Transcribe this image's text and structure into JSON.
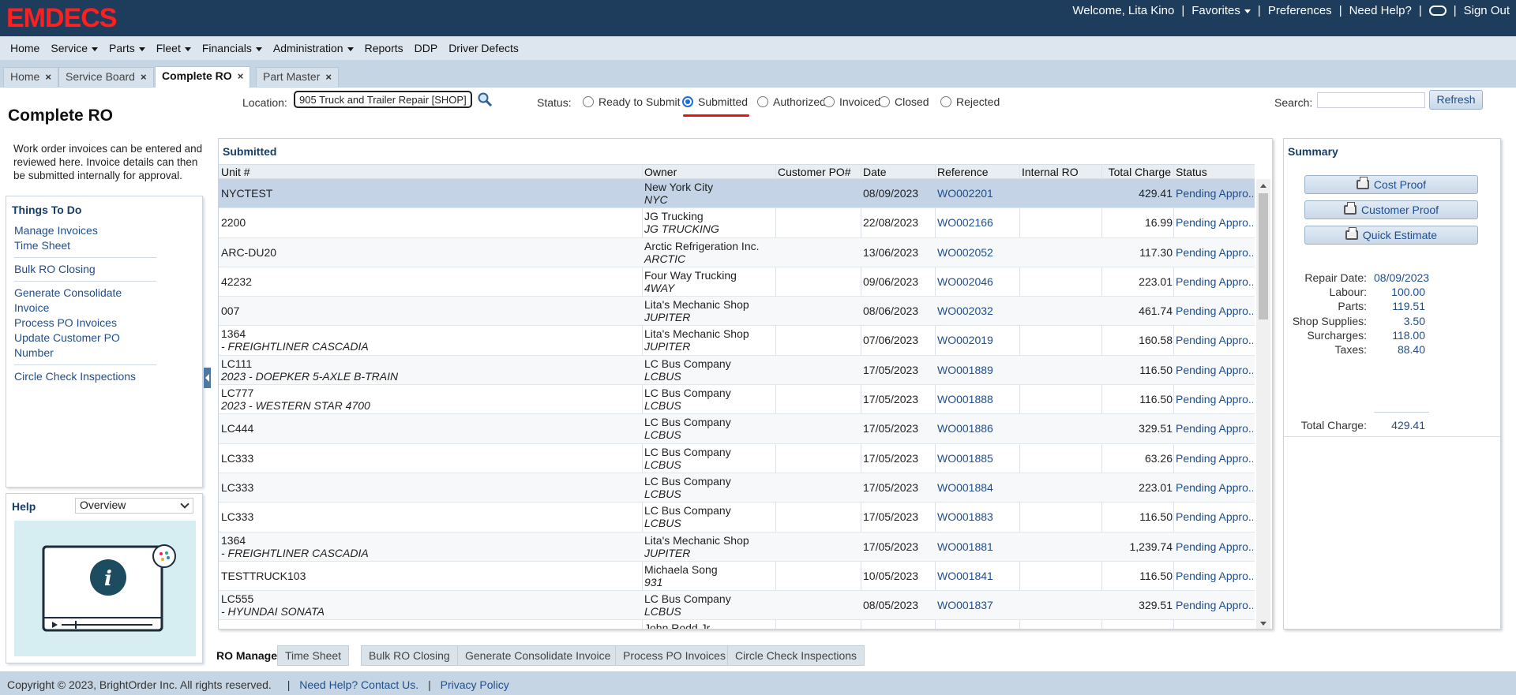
{
  "app": {
    "logo": "EMDECS"
  },
  "user_bar": {
    "welcome": "Welcome, Lita Kino",
    "favorites": "Favorites",
    "preferences": "Preferences",
    "need_help": "Need Help?",
    "sign_out": "Sign Out"
  },
  "menu": [
    "Home",
    "Service",
    "Parts",
    "Fleet",
    "Financials",
    "Administration",
    "Reports",
    "DDP",
    "Driver Defects"
  ],
  "menu_dropdown": [
    false,
    true,
    true,
    true,
    true,
    true,
    false,
    false,
    false
  ],
  "tabs": [
    {
      "label": "Home"
    },
    {
      "label": "Service Board"
    },
    {
      "label": "Complete RO",
      "active": true
    },
    {
      "label": "Part Master"
    }
  ],
  "sidebar": {
    "title": "Complete RO",
    "intro": "Work order invoices can be entered and reviewed here. Invoice details can then be submitted internally for approval.",
    "todo_title": "Things To Do",
    "todo_links": [
      [
        "Manage Invoices",
        "Time Sheet"
      ],
      [
        "Bulk RO Closing"
      ],
      [
        "Generate Consolidate Invoice",
        "Process PO Invoices",
        "Update Customer PO Number"
      ],
      [
        "Circle Check Inspections"
      ]
    ],
    "help_title": "Help",
    "help_select": "Overview"
  },
  "filter": {
    "location_label": "Location:",
    "location_value": "905 Truck and Trailer Repair [SHOP]",
    "status_label": "Status:",
    "statuses": [
      "Ready to Submit",
      "Submitted",
      "Authorized",
      "Invoiced",
      "Closed",
      "Rejected"
    ],
    "selected_status": "Submitted",
    "search_label": "Search:",
    "search_value": "",
    "refresh": "Refresh"
  },
  "grid": {
    "title": "Submitted",
    "columns": [
      "Unit #",
      "Owner",
      "Customer PO#",
      "Date",
      "Reference",
      "Internal RO",
      "Total Charge",
      "Status"
    ],
    "rows": [
      {
        "unit": "NYCTEST",
        "unit2": "",
        "owner": "New York City",
        "owner2": "NYC",
        "po": "",
        "date": "08/09/2023",
        "ref": "WO002201",
        "iro": "",
        "total": "429.41",
        "status": "Pending Appro..."
      },
      {
        "unit": "2200",
        "unit2": "",
        "owner": "JG Trucking",
        "owner2": "JG TRUCKING",
        "po": "",
        "date": "22/08/2023",
        "ref": "WO002166",
        "iro": "",
        "total": "16.99",
        "status": "Pending Appro..."
      },
      {
        "unit": "ARC-DU20",
        "unit2": "",
        "owner": "Arctic Refrigeration Inc.",
        "owner2": "ARCTIC",
        "po": "",
        "date": "13/06/2023",
        "ref": "WO002052",
        "iro": "",
        "total": "117.30",
        "status": "Pending Appro..."
      },
      {
        "unit": "42232",
        "unit2": "",
        "owner": "Four Way Trucking",
        "owner2": "4WAY",
        "po": "",
        "date": "09/06/2023",
        "ref": "WO002046",
        "iro": "",
        "total": "223.01",
        "status": "Pending Appro..."
      },
      {
        "unit": "007",
        "unit2": "",
        "owner": "Lita's Mechanic Shop",
        "owner2": "JUPITER",
        "po": "",
        "date": "08/06/2023",
        "ref": "WO002032",
        "iro": "",
        "total": "461.74",
        "status": "Pending Appro..."
      },
      {
        "unit": "1364",
        "unit2": "- FREIGHTLINER CASCADIA",
        "owner": "Lita's Mechanic Shop",
        "owner2": "JUPITER",
        "po": "",
        "date": "07/06/2023",
        "ref": "WO002019",
        "iro": "",
        "total": "160.58",
        "status": "Pending Appro..."
      },
      {
        "unit": "LC111",
        "unit2": "2023 - DOEPKER 5-AXLE B-TRAIN",
        "owner": "LC Bus Company",
        "owner2": "LCBUS",
        "po": "",
        "date": "17/05/2023",
        "ref": "WO001889",
        "iro": "",
        "total": "116.50",
        "status": "Pending Appro..."
      },
      {
        "unit": "LC777",
        "unit2": "2023 - WESTERN STAR 4700",
        "owner": "LC Bus Company",
        "owner2": "LCBUS",
        "po": "",
        "date": "17/05/2023",
        "ref": "WO001888",
        "iro": "",
        "total": "116.50",
        "status": "Pending Appro..."
      },
      {
        "unit": "LC444",
        "unit2": "",
        "owner": "LC Bus Company",
        "owner2": "LCBUS",
        "po": "",
        "date": "17/05/2023",
        "ref": "WO001886",
        "iro": "",
        "total": "329.51",
        "status": "Pending Appro..."
      },
      {
        "unit": "LC333",
        "unit2": "",
        "owner": "LC Bus Company",
        "owner2": "LCBUS",
        "po": "",
        "date": "17/05/2023",
        "ref": "WO001885",
        "iro": "",
        "total": "63.26",
        "status": "Pending Appro..."
      },
      {
        "unit": "LC333",
        "unit2": "",
        "owner": "LC Bus Company",
        "owner2": "LCBUS",
        "po": "",
        "date": "17/05/2023",
        "ref": "WO001884",
        "iro": "",
        "total": "223.01",
        "status": "Pending Appro..."
      },
      {
        "unit": "LC333",
        "unit2": "",
        "owner": "LC Bus Company",
        "owner2": "LCBUS",
        "po": "",
        "date": "17/05/2023",
        "ref": "WO001883",
        "iro": "",
        "total": "116.50",
        "status": "Pending Appro..."
      },
      {
        "unit": "1364",
        "unit2": "- FREIGHTLINER CASCADIA",
        "owner": "Lita's Mechanic Shop",
        "owner2": "JUPITER",
        "po": "",
        "date": "17/05/2023",
        "ref": "WO001881",
        "iro": "",
        "total": "1,239.74",
        "status": "Pending Appro..."
      },
      {
        "unit": "TESTTRUCK103",
        "unit2": "",
        "owner": "Michaela Song",
        "owner2": "931",
        "po": "",
        "date": "10/05/2023",
        "ref": "WO001841",
        "iro": "",
        "total": "116.50",
        "status": "Pending Appro..."
      },
      {
        "unit": "LC555",
        "unit2": "- HYUNDAI SONATA",
        "owner": "LC Bus Company",
        "owner2": "LCBUS",
        "po": "",
        "date": "08/05/2023",
        "ref": "WO001837",
        "iro": "",
        "total": "329.51",
        "status": "Pending Appro..."
      },
      {
        "unit": "",
        "unit2": "",
        "owner": "John Rodd Jr",
        "owner2": "",
        "po": "",
        "date": "",
        "ref": "",
        "iro": "",
        "total": "",
        "status": ""
      }
    ]
  },
  "summary": {
    "title": "Summary",
    "buttons": [
      "Cost Proof",
      "Customer Proof",
      "Quick Estimate"
    ],
    "fields": [
      {
        "label": "Repair Date:",
        "value": "08/09/2023"
      },
      {
        "label": "Labour:",
        "value": "100.00"
      },
      {
        "label": "Parts:",
        "value": "119.51"
      },
      {
        "label": "Shop Supplies:",
        "value": "3.50"
      },
      {
        "label": "Surcharges:",
        "value": "118.00"
      },
      {
        "label": "Taxes:",
        "value": "88.40"
      }
    ],
    "total_label": "Total Charge:",
    "total_value": "429.41"
  },
  "bottom_tabs": [
    "RO Manager",
    "Time Sheet",
    "Bulk RO Closing",
    "Generate Consolidate Invoice",
    "Process PO Invoices",
    "Circle Check Inspections"
  ],
  "footer": {
    "copyright": "Copyright © 2023, BrightOrder Inc. All rights reserved.",
    "help": "Need Help? Contact Us.",
    "privacy": "Privacy Policy"
  },
  "colors": {
    "header": "#1e3d5c",
    "logo": "#ff1f1f",
    "link": "#1f4e8c",
    "selected_row": "#c4d4e6",
    "radio": "#1a6ed8",
    "highlight": "#ee1111"
  },
  "icons": [
    "search-icon",
    "close-icon",
    "caret-down-icon",
    "printer-icon",
    "info-video-icon",
    "toggle-icon",
    "collapse-arrow-icon"
  ]
}
